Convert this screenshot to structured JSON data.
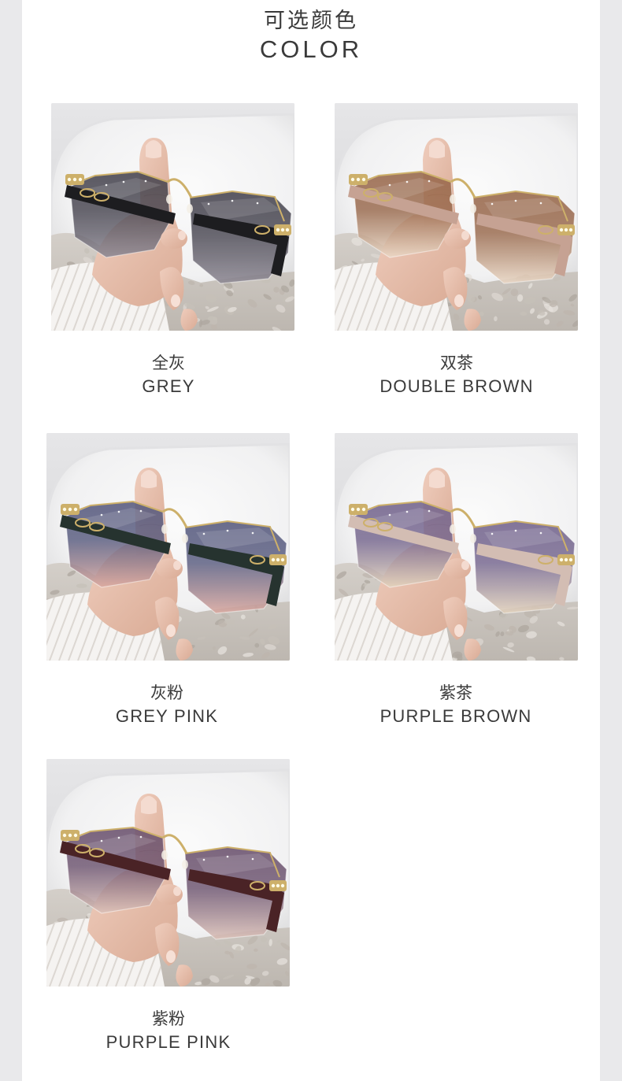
{
  "header": {
    "title_cn": "可选颜色",
    "title_en": "COLOR"
  },
  "theme": {
    "side_bar": "#e9e9eb",
    "text": "#3a3a3a",
    "gold": "#cdb06a"
  },
  "colors": [
    {
      "name_cn": "全灰",
      "name_en": "GREY",
      "lens_top": "#46444f",
      "lens_bottom": "#8f8a95",
      "temple": "#1d1d20"
    },
    {
      "name_cn": "双茶",
      "name_en": "DOUBLE BROWN",
      "lens_top": "#97674a",
      "lens_bottom": "#ebd9c7",
      "temple": "#c6a293"
    },
    {
      "name_cn": "灰粉",
      "name_en": "GREY PINK",
      "lens_top": "#575a7e",
      "lens_bottom": "#dba9a0",
      "temple": "#26332f"
    },
    {
      "name_cn": "紫茶",
      "name_en": "PURPLE BROWN",
      "lens_top": "#73648d",
      "lens_bottom": "#e4d4bd",
      "temple": "#d3bdb3"
    },
    {
      "name_cn": "紫粉",
      "name_en": "PURPLE PINK",
      "lens_top": "#6b526e",
      "lens_bottom": "#ddc2b9",
      "temple": "#4a2326"
    }
  ]
}
